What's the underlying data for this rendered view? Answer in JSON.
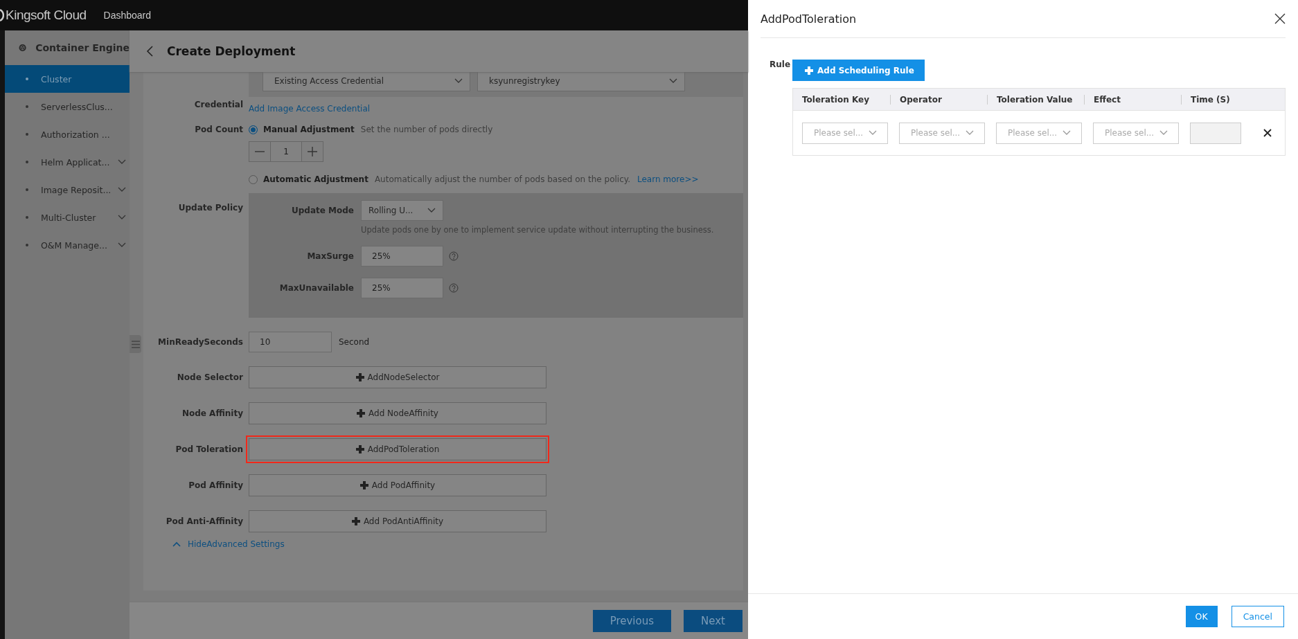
{
  "top_bar": {
    "logo": "Kingsoft Cloud",
    "nav": "Dashboard"
  },
  "sidebar": {
    "title": "Container Engine",
    "items": [
      {
        "label": "Cluster",
        "selected": true,
        "expandable": false
      },
      {
        "label": "ServerlessClus...",
        "selected": false,
        "expandable": false
      },
      {
        "label": "Authorization ...",
        "selected": false,
        "expandable": false
      },
      {
        "label": "Helm Applicat...",
        "selected": false,
        "expandable": true
      },
      {
        "label": "Image Reposit...",
        "selected": false,
        "expandable": true
      },
      {
        "label": "Multi-Cluster",
        "selected": false,
        "expandable": true
      },
      {
        "label": "O&M Manage...",
        "selected": false,
        "expandable": true
      }
    ]
  },
  "page": {
    "title": "Create Deployment",
    "credential": {
      "label": "Credential",
      "selects": [
        "Existing Access Credential",
        "ksyunregistrykey"
      ],
      "link": "Add Image Access Credential"
    },
    "pod_count": {
      "label": "Pod Count",
      "stepper_value": "1",
      "options": [
        {
          "label": "Manual Adjustment",
          "hint": "Set the number of pods directly",
          "selected": true
        },
        {
          "label": "Automatic Adjustment",
          "hint": "Automatically adjust the number of pods based on the policy.",
          "link": "Learn more>>",
          "selected": false
        }
      ]
    },
    "update_policy": {
      "label": "Update Policy",
      "fields": [
        {
          "kind": "select",
          "label": "Update Mode",
          "value": "Rolling U...",
          "hint": "Update pods one by one to implement service update without interrupting the business."
        },
        {
          "kind": "input_with_help",
          "label": "MaxSurge",
          "value": "25%"
        },
        {
          "kind": "input_with_help",
          "label": "MaxUnavailable",
          "value": "25%"
        }
      ]
    },
    "min_ready": {
      "label": "MinReadySeconds",
      "value": "10",
      "unit": "Second"
    },
    "add_rows": [
      {
        "label": "Node Selector",
        "button": "AddNodeSelector",
        "highlighted": false
      },
      {
        "label": "Node Affinity",
        "button": "Add NodeAffinity",
        "highlighted": false
      },
      {
        "label": "Pod Toleration",
        "button": "AddPodToleration",
        "highlighted": true
      },
      {
        "label": "Pod Affinity",
        "button": "Add PodAffinity",
        "highlighted": false
      },
      {
        "label": "Pod Anti-Affinity",
        "button": "Add PodAntiAffinity",
        "highlighted": false
      }
    ],
    "toggle_link": "HideAdvanced Settings",
    "footer_buttons": [
      "Previous",
      "Next"
    ]
  },
  "drawer": {
    "title": "AddPodToleration",
    "rule_label": "Rule",
    "add_button": "Add Scheduling Rule",
    "table": {
      "columns": [
        "Toleration Key",
        "Operator",
        "Toleration Value",
        "Effect",
        "Time (S)"
      ],
      "rows": [
        {
          "cells": [
            {
              "kind": "select",
              "placeholder": "Please sel..."
            },
            {
              "kind": "select",
              "placeholder": "Please sel..."
            },
            {
              "kind": "select",
              "placeholder": "Please sel..."
            },
            {
              "kind": "select",
              "placeholder": "Please sel..."
            },
            {
              "kind": "input",
              "disabled": true
            }
          ]
        }
      ]
    },
    "buttons": [
      {
        "label": "OK",
        "kind": "primary"
      },
      {
        "label": "Cancel",
        "kind": "default"
      }
    ]
  }
}
